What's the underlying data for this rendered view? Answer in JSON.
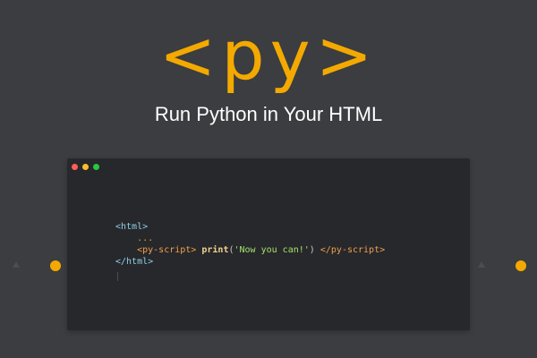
{
  "hero": {
    "logo": "<py>",
    "tagline": "Run Python in Your HTML"
  },
  "code_window": {
    "lines": {
      "html_open": "<html>",
      "ellipsis": "...",
      "py_open": "<py-script>",
      "print_fn": "print",
      "paren_open": "(",
      "string": "'Now you can!'",
      "paren_close": ")",
      "py_close": "</py-script>",
      "html_close": "</html>"
    }
  },
  "colors": {
    "background": "#3b3d40",
    "accent": "#f4a900",
    "code_background": "#27282b"
  },
  "icons": {
    "nav_left": "triangle-up-icon",
    "nav_right": "triangle-up-icon",
    "indicator": "dot-icon"
  }
}
